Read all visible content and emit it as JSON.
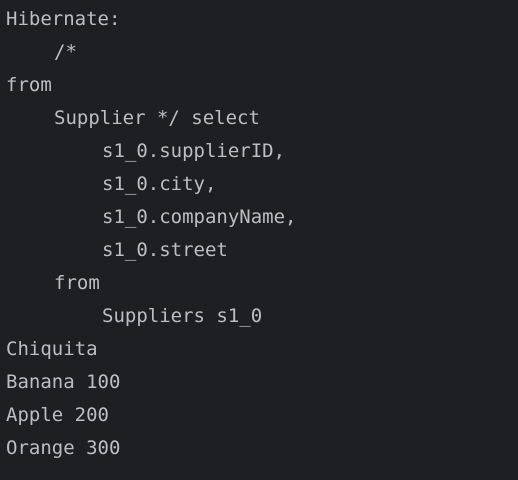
{
  "console": {
    "lines": [
      "Hibernate:",
      "/*",
      "from",
      "Supplier */ select",
      "s1_0.supplierID,",
      "s1_0.city,",
      "s1_0.companyName,",
      "s1_0.street",
      "from",
      "Suppliers s1_0",
      "Chiquita",
      "Banana 100",
      "Apple 200",
      "Orange 300"
    ]
  }
}
